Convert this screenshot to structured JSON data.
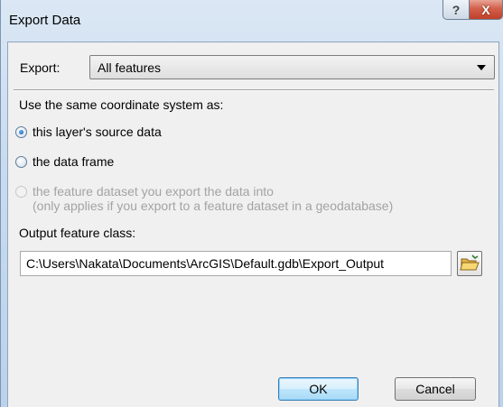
{
  "window": {
    "title": "Export Data",
    "help_glyph": "?",
    "close_glyph": "X"
  },
  "export": {
    "label": "Export:",
    "selected": "All features"
  },
  "coordinate_system": {
    "heading": "Use the same coordinate system as:",
    "options": [
      {
        "label": "this layer's source data",
        "checked": true,
        "enabled": true
      },
      {
        "label": "the data frame",
        "checked": false,
        "enabled": true
      },
      {
        "label": "the feature dataset you export the data into",
        "note": "(only applies if you export to a feature dataset in a geodatabase)",
        "checked": false,
        "enabled": false
      }
    ]
  },
  "output": {
    "label": "Output feature class:",
    "value": "C:\\Users\\Nakata\\Documents\\ArcGIS\\Default.gdb\\Export_Output",
    "browse_icon": "open-folder-icon"
  },
  "buttons": {
    "ok": "OK",
    "cancel": "Cancel"
  },
  "colors": {
    "title_bar": "#c9dbee",
    "close_button": "#c8452e",
    "dialog_background": "#f0f0f0",
    "default_button": "#bee6fd"
  }
}
